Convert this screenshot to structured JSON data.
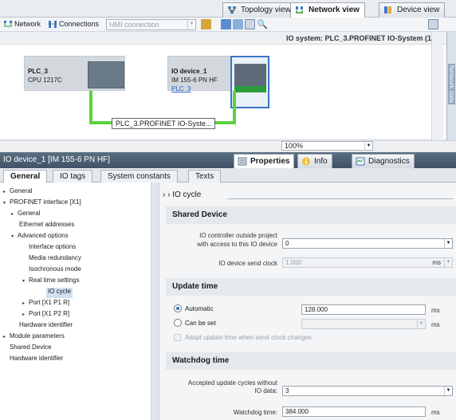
{
  "view_tabs": {
    "topology": "Topology view",
    "network": "Network view",
    "device": "Device view"
  },
  "toolbar": {
    "network_label": "Network",
    "connections_label": "Connections",
    "hmi_placeholder": "HMI connection"
  },
  "io_system_label": "IO system: PLC_3.PROFINET IO-System (100)",
  "devices": {
    "plc": {
      "name": "PLC_3",
      "type": "CPU 1217C"
    },
    "io": {
      "name": "IO device_1",
      "type": "IM 155-6 PN HF",
      "link": "PLC_3"
    }
  },
  "network_label": "PLC_3.PROFINET IO-Syste...",
  "side_tab": "Network data",
  "zoom": "100%",
  "inspector": {
    "title": "IO device_1 [IM 155-6 PN HF]",
    "properties": "Properties",
    "info": "Info",
    "diagnostics": "Diagnostics"
  },
  "subtabs": [
    "General",
    "IO tags",
    "System constants",
    "Texts"
  ],
  "tree": [
    {
      "label": "General",
      "arrow": "▸"
    },
    {
      "label": "PROFINET interface [X1]",
      "arrow": "▾"
    },
    {
      "label": "General",
      "arrow": "▸"
    },
    {
      "label": "Ethernet addresses",
      "arrow": ""
    },
    {
      "label": "Advanced options",
      "arrow": "▾"
    },
    {
      "label": "Interface options",
      "arrow": ""
    },
    {
      "label": "Media redundancy",
      "arrow": ""
    },
    {
      "label": "Isochronous mode",
      "arrow": ""
    },
    {
      "label": "Real time settings",
      "arrow": "▾"
    },
    {
      "label": "IO cycle",
      "arrow": ""
    },
    {
      "label": "Port [X1 P1 R]",
      "arrow": "▸"
    },
    {
      "label": "Port [X1 P2 R]",
      "arrow": "▸"
    },
    {
      "label": "Hardware identifier",
      "arrow": ""
    },
    {
      "label": "Module parameters",
      "arrow": "▸"
    },
    {
      "label": "Shared Device",
      "arrow": ""
    },
    {
      "label": "Hardware identifier",
      "arrow": ""
    }
  ],
  "content": {
    "breadcrumb": "IO cycle",
    "shared_device": {
      "title": "Shared Device",
      "controller_label_1": "IO controller outside project",
      "controller_label_2": "with access to this IO device",
      "controller_value": "0",
      "send_clock_label": "IO device send clock",
      "send_clock_value": "1.000",
      "send_clock_unit": "ms"
    },
    "update_time": {
      "title": "Update time",
      "automatic_label": "Automatic",
      "automatic_value": "128.000",
      "automatic_unit": "ms",
      "can_be_set_label": "Can be set",
      "can_be_set_unit": "ms",
      "adapt_label": "Adapt update time when send clock changes"
    },
    "watchdog": {
      "title": "Watchdog time",
      "cycles_label_1": "Accepted update cycles without",
      "cycles_label_2": "IO data:",
      "cycles_value": "3",
      "watchdog_label": "Watchdog time:",
      "watchdog_value": "384.000",
      "watchdog_unit": "ms"
    }
  }
}
